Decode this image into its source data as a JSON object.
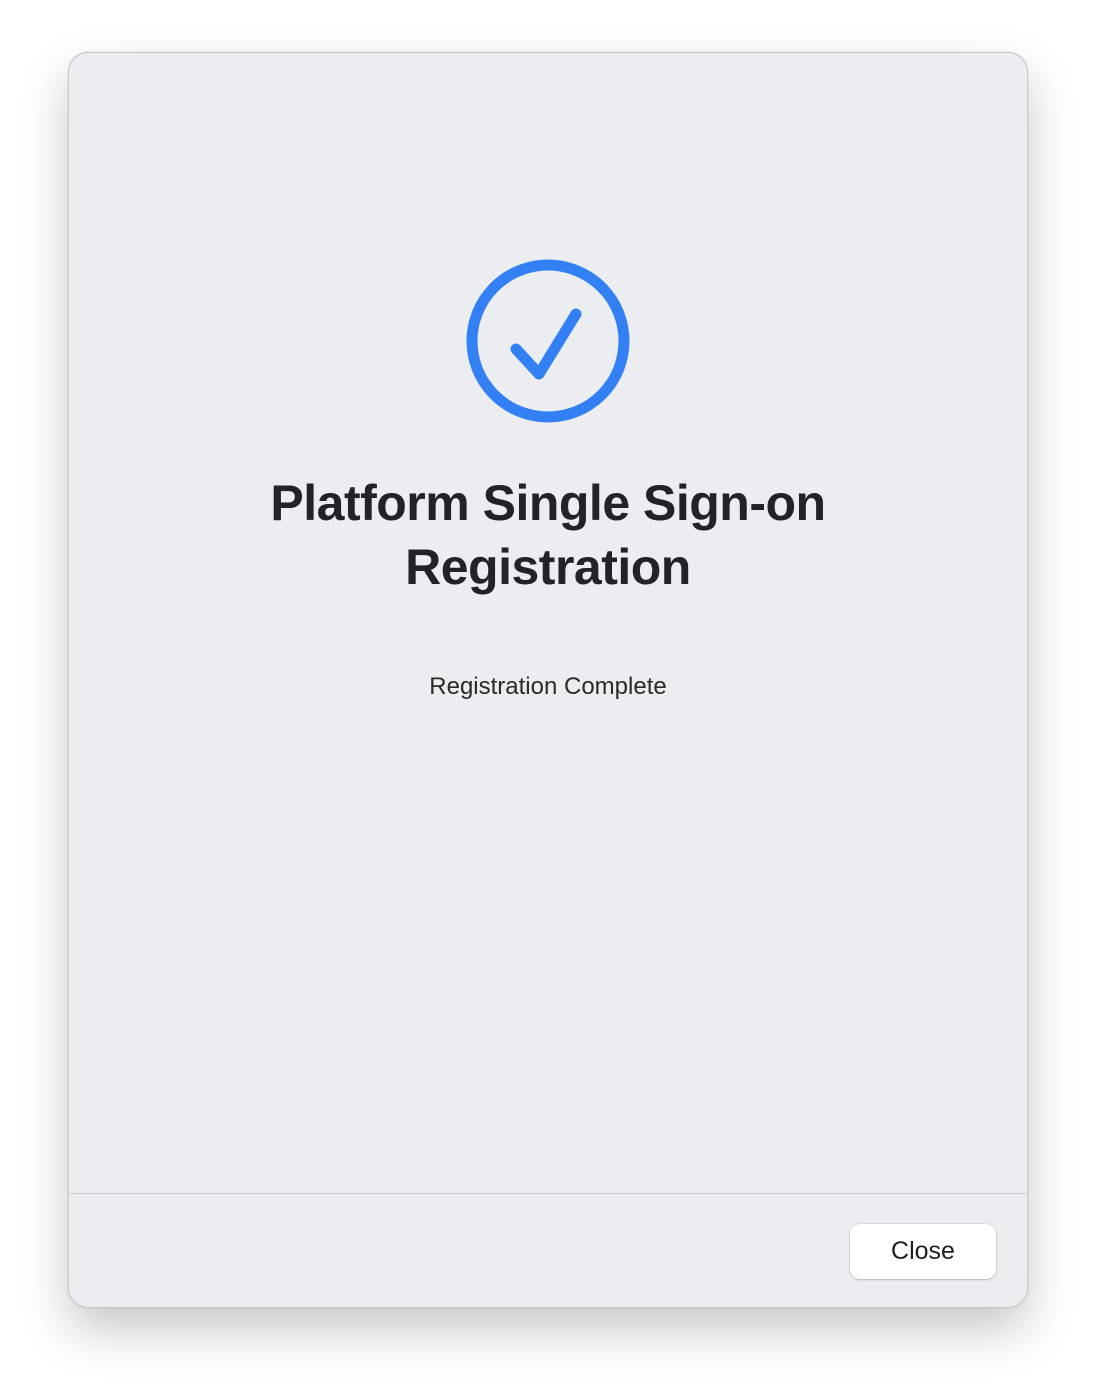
{
  "dialog": {
    "icon": "checkmark-circle-icon",
    "title_line1": "Platform Single Sign-on",
    "title_line2": "Registration",
    "status": "Registration Complete",
    "close_label": "Close"
  },
  "colors": {
    "accent": "#3380f5",
    "background": "#ecedf1",
    "title": "#222326"
  }
}
